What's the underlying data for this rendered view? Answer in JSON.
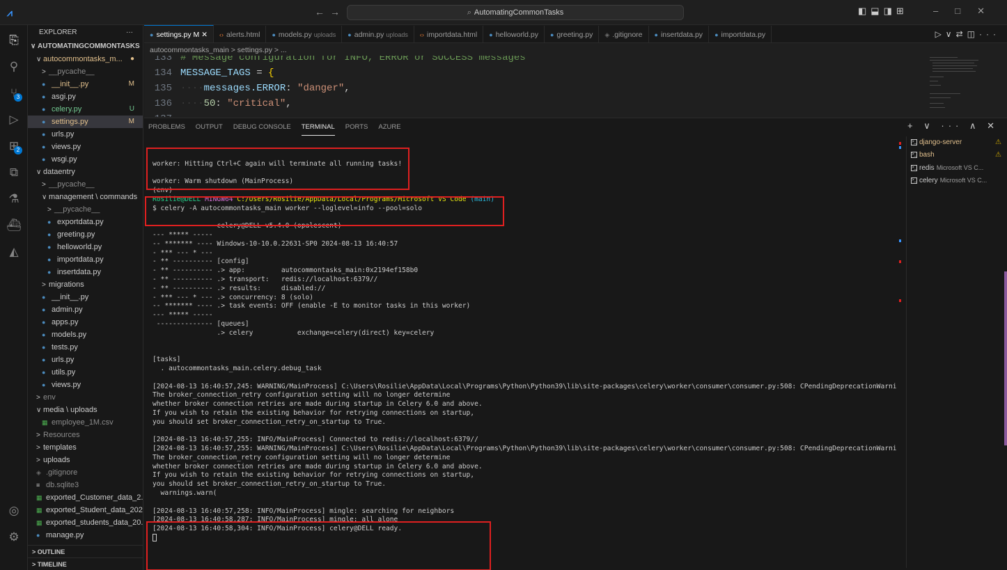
{
  "window": {
    "command_center": "AutomatingCommonTasks"
  },
  "activity_bar": {
    "scm_badge": "3",
    "extensions_badge": "2"
  },
  "explorer": {
    "title": "EXPLORER",
    "more": "···",
    "workspace": "AUTOMATINGCOMMONTASKS",
    "tree": [
      {
        "indent": 1,
        "chev": "∨",
        "label": "autocommontasks_m...",
        "status": "●",
        "status_class": "mod",
        "label_class": "mod"
      },
      {
        "indent": 2,
        "chev": ">",
        "label": "__pycache__",
        "label_class": "dim"
      },
      {
        "indent": 2,
        "icon": "py",
        "label": "__init__.py",
        "status": "M",
        "status_class": "mod",
        "label_class": "mod"
      },
      {
        "indent": 2,
        "icon": "py",
        "label": "asgi.py"
      },
      {
        "indent": 2,
        "icon": "py",
        "label": "celery.py",
        "status": "U",
        "status_class": "unt",
        "label_class": "unt"
      },
      {
        "indent": 2,
        "icon": "py",
        "label": "settings.py",
        "status": "M",
        "status_class": "mod",
        "label_class": "mod",
        "selected": true
      },
      {
        "indent": 2,
        "icon": "py",
        "label": "urls.py"
      },
      {
        "indent": 2,
        "icon": "py",
        "label": "views.py"
      },
      {
        "indent": 2,
        "icon": "py",
        "label": "wsgi.py"
      },
      {
        "indent": 1,
        "chev": "∨",
        "label": "dataentry"
      },
      {
        "indent": 2,
        "chev": ">",
        "label": "__pycache__",
        "label_class": "dim"
      },
      {
        "indent": 2,
        "chev": "∨",
        "label": "management \\ commands"
      },
      {
        "indent": 3,
        "chev": ">",
        "label": "__pycache__",
        "label_class": "dim"
      },
      {
        "indent": 3,
        "icon": "py",
        "label": "exportdata.py"
      },
      {
        "indent": 3,
        "icon": "py",
        "label": "greeting.py"
      },
      {
        "indent": 3,
        "icon": "py",
        "label": "helloworld.py"
      },
      {
        "indent": 3,
        "icon": "py",
        "label": "importdata.py"
      },
      {
        "indent": 3,
        "icon": "py",
        "label": "insertdata.py"
      },
      {
        "indent": 2,
        "chev": ">",
        "label": "migrations"
      },
      {
        "indent": 2,
        "icon": "py",
        "label": "__init__.py"
      },
      {
        "indent": 2,
        "icon": "py",
        "label": "admin.py"
      },
      {
        "indent": 2,
        "icon": "py",
        "label": "apps.py"
      },
      {
        "indent": 2,
        "icon": "py",
        "label": "models.py"
      },
      {
        "indent": 2,
        "icon": "py",
        "label": "tests.py"
      },
      {
        "indent": 2,
        "icon": "py",
        "label": "urls.py"
      },
      {
        "indent": 2,
        "icon": "py",
        "label": "utils.py"
      },
      {
        "indent": 2,
        "icon": "py",
        "label": "views.py"
      },
      {
        "indent": 1,
        "chev": ">",
        "label": "env",
        "label_class": "dim"
      },
      {
        "indent": 1,
        "chev": "∨",
        "label": "media \\ uploads"
      },
      {
        "indent": 2,
        "icon": "csv",
        "label": "employee_1M.csv",
        "label_class": "dim"
      },
      {
        "indent": 1,
        "chev": ">",
        "label": "Resources",
        "label_class": "dim"
      },
      {
        "indent": 1,
        "chev": ">",
        "label": "templates"
      },
      {
        "indent": 1,
        "chev": ">",
        "label": "uploads"
      },
      {
        "indent": 1,
        "icon": "git",
        "label": ".gitignore",
        "label_class": "dim"
      },
      {
        "indent": 1,
        "icon": "db",
        "label": "db.sqlite3",
        "label_class": "dim"
      },
      {
        "indent": 1,
        "icon": "csv",
        "label": "exported_Customer_data_2..."
      },
      {
        "indent": 1,
        "icon": "csv",
        "label": "exported_Student_data_202..."
      },
      {
        "indent": 1,
        "icon": "csv",
        "label": "exported_students_data_20..."
      },
      {
        "indent": 1,
        "icon": "py",
        "label": "manage.py"
      }
    ],
    "outline": "> OUTLINE",
    "timeline": "> TIMELINE"
  },
  "tabs": [
    {
      "label": "settings.py",
      "suffix": " M ✕",
      "icon": "py",
      "active": true
    },
    {
      "label": "alerts.html",
      "icon": "html"
    },
    {
      "label": "models.py",
      "desc": "uploads",
      "icon": "py"
    },
    {
      "label": "admin.py",
      "desc": "uploads",
      "icon": "py"
    },
    {
      "label": "importdata.html",
      "icon": "html"
    },
    {
      "label": "helloworld.py",
      "icon": "py"
    },
    {
      "label": "greeting.py",
      "icon": "py"
    },
    {
      "label": ".gitignore",
      "icon": "git"
    },
    {
      "label": "insertdata.py",
      "icon": "py"
    },
    {
      "label": "importdata.py",
      "icon": "py"
    }
  ],
  "breadcrumb": "autocommontasks_main  >  settings.py  >  ...",
  "code": {
    "l133_num": "133",
    "l133_text": "# Message configuration for INFO, ERROR or SUCCESS messages",
    "l134_num": "134",
    "l134_name": "MESSAGE_TAGS",
    "l134_eq": " = ",
    "l134_brace": "{",
    "l135_num": "135",
    "l135_key": "messages.ERROR",
    "l135_colon": ": ",
    "l135_val": "\"danger\"",
    "l135_comma": ",",
    "l136_num": "136",
    "l136_key": "50",
    "l136_colon": ": ",
    "l136_val": "\"critical\"",
    "l136_comma": ",",
    "l137_num": "137"
  },
  "panel": {
    "tabs": [
      "PROBLEMS",
      "OUTPUT",
      "DEBUG CONSOLE",
      "TERMINAL",
      "PORTS",
      "AZURE"
    ],
    "active_tab": "TERMINAL",
    "actions": "+ ∨  ···  ∧  ✕"
  },
  "terminal": {
    "lines": [
      "",
      "",
      "worker: Hitting Ctrl+C again will terminate all running tasks!",
      "",
      "worker: Warm shutdown (MainProcess)",
      "(env)",
      "__PROMPT__",
      "$ celery -A autocommontasks_main worker --loglevel=info --pool=solo",
      "",
      " -------------- celery@DELL v5.4.0 (opalescent)",
      "--- ***** -----",
      "-- ******* ---- Windows-10-10.0.22631-SP0 2024-08-13 16:40:57",
      "- *** --- * ---",
      "- ** ---------- [config]",
      "- ** ---------- .> app:         autocommontasks_main:0x2194ef158b0",
      "- ** ---------- .> transport:   redis://localhost:6379//",
      "- ** ---------- .> results:     disabled://",
      "- *** --- * --- .> concurrency: 8 (solo)",
      "-- ******* ---- .> task events: OFF (enable -E to monitor tasks in this worker)",
      "--- ***** -----",
      " -------------- [queues]",
      "                .> celery           exchange=celery(direct) key=celery",
      "",
      "",
      "[tasks]",
      "  . autocommontasks_main.celery.debug_task",
      "",
      "[2024-08-13 16:40:57,245: WARNING/MainProcess] C:\\Users\\Rosilie\\AppData\\Local\\Programs\\Python\\Python39\\lib\\site-packages\\celery\\worker\\consumer\\consumer.py:508: CPendingDeprecationWarning:",
      "The broker_connection_retry configuration setting will no longer determine",
      "whether broker connection retries are made during startup in Celery 6.0 and above.",
      "If you wish to retain the existing behavior for retrying connections on startup,",
      "you should set broker_connection_retry_on_startup to True.",
      "",
      "[2024-08-13 16:40:57,255: INFO/MainProcess] Connected to redis://localhost:6379//",
      "[2024-08-13 16:40:57,255: WARNING/MainProcess] C:\\Users\\Rosilie\\AppData\\Local\\Programs\\Python\\Python39\\lib\\site-packages\\celery\\worker\\consumer\\consumer.py:508: CPendingDeprecationWarning:",
      "The broker_connection_retry configuration setting will no longer determine",
      "whether broker connection retries are made during startup in Celery 6.0 and above.",
      "If you wish to retain the existing behavior for retrying connections on startup,",
      "you should set broker_connection_retry_on_startup to True.",
      "  warnings.warn(",
      "",
      "[2024-08-13 16:40:57,258: INFO/MainProcess] mingle: searching for neighbors",
      "[2024-08-13 16:40:58,287: INFO/MainProcess] mingle: all alone",
      "[2024-08-13 16:40:58,304: INFO/MainProcess] celery@DELL ready.",
      "__CURSOR__"
    ],
    "prompt": {
      "user": "Rosilie@DELL",
      "shell": "MINGW64",
      "path": "C:/Users/Rosilie/AppData/Local/Programs/Microsoft VS Code",
      "branch": "(main)"
    }
  },
  "terminal_list": [
    {
      "name": "django-server",
      "warn": true,
      "name_class": "warnname"
    },
    {
      "name": "bash",
      "warn": true,
      "name_class": "warnname"
    },
    {
      "name": "redis",
      "sub": "Microsoft VS C..."
    },
    {
      "name": "celery",
      "sub": "Microsoft VS C..."
    }
  ],
  "colors": {
    "accent": "#0078d4",
    "highlight_box": "#e02020",
    "modified": "#e2c08d",
    "untracked": "#73c991"
  }
}
